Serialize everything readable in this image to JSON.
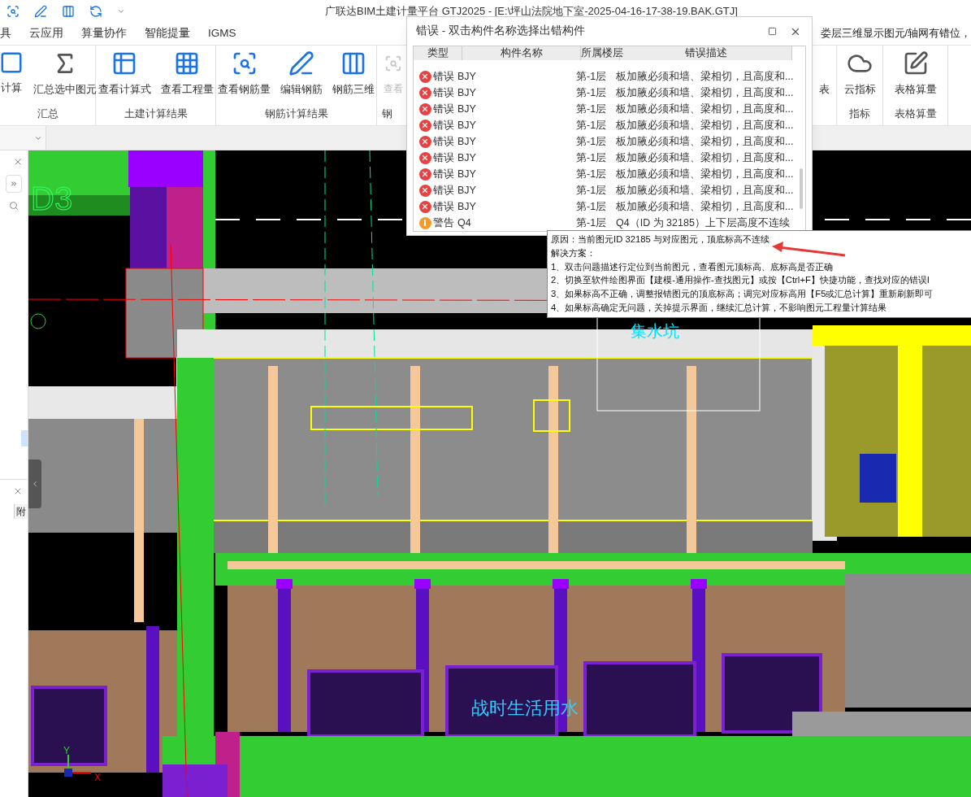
{
  "title_bar": {
    "title": "广联达BIM土建计量平台 GTJ2025 - [E:\\坪山法院地下室-2025-04-16-17-38-19.BAK.GTJ]"
  },
  "menu": [
    {
      "label": "具",
      "selected": false
    },
    {
      "label": "云应用",
      "selected": false
    },
    {
      "label": "算量协作",
      "selected": false
    },
    {
      "label": "智能提量",
      "selected": false
    },
    {
      "label": "IGMS",
      "selected": false
    }
  ],
  "notice": "娄层三维显示图元/轴网有错位，",
  "ribbon_left": [
    {
      "label": "汇总",
      "items": [
        {
          "kind": "calc",
          "label": "计算",
          "disabled": false
        },
        {
          "kind": "sum",
          "label": "汇总选中图元",
          "disabled": false
        }
      ]
    },
    {
      "label": "土建计算结果",
      "items": [
        {
          "kind": "formula",
          "label": "查看计算式",
          "disabled": false
        },
        {
          "kind": "quantity",
          "label": "查看工程量",
          "disabled": false
        }
      ]
    },
    {
      "label": "钢筋计算结果",
      "items": [
        {
          "kind": "rebar-qty",
          "label": "查看钢筋量",
          "disabled": false
        },
        {
          "kind": "rebar-edit",
          "label": "编辑钢筋",
          "disabled": false
        },
        {
          "kind": "rebar-3d",
          "label": "钢筋三维",
          "disabled": false
        }
      ]
    },
    {
      "label": "钢",
      "items": [
        {
          "kind": "view",
          "label": "查看",
          "disabled": true
        }
      ]
    }
  ],
  "ribbon_right": [
    {
      "items": [
        {
          "kind": "none",
          "label": "表",
          "disabled": false
        }
      ]
    },
    {
      "label": "指标",
      "items": [
        {
          "kind": "cloud-index",
          "label": "云指标",
          "disabled": false
        }
      ]
    },
    {
      "label": "表格算量",
      "items": [
        {
          "kind": "table-calc",
          "label": "表格算量",
          "disabled": false
        }
      ]
    }
  ],
  "dialog": {
    "title": "错误 - 双击构件名称选择出错构件",
    "columns": [
      "类型",
      "构件名称",
      "所属楼层",
      "错误描述"
    ],
    "rows": [
      {
        "kind": "error",
        "type": "错误",
        "name": "BJY",
        "floor": "第-1层",
        "description": "板加腋必须和墙、梁相切，且高度和..."
      },
      {
        "kind": "error",
        "type": "错误",
        "name": "BJY",
        "floor": "第-1层",
        "description": "板加腋必须和墙、梁相切，且高度和..."
      },
      {
        "kind": "error",
        "type": "错误",
        "name": "BJY",
        "floor": "第-1层",
        "description": "板加腋必须和墙、梁相切，且高度和..."
      },
      {
        "kind": "error",
        "type": "错误",
        "name": "BJY",
        "floor": "第-1层",
        "description": "板加腋必须和墙、梁相切，且高度和..."
      },
      {
        "kind": "error",
        "type": "错误",
        "name": "BJY",
        "floor": "第-1层",
        "description": "板加腋必须和墙、梁相切，且高度和..."
      },
      {
        "kind": "error",
        "type": "错误",
        "name": "BJY",
        "floor": "第-1层",
        "description": "板加腋必须和墙、梁相切，且高度和..."
      },
      {
        "kind": "error",
        "type": "错误",
        "name": "BJY",
        "floor": "第-1层",
        "description": "板加腋必须和墙、梁相切，且高度和..."
      },
      {
        "kind": "error",
        "type": "错误",
        "name": "BJY",
        "floor": "第-1层",
        "description": "板加腋必须和墙、梁相切，且高度和..."
      },
      {
        "kind": "error",
        "type": "错误",
        "name": "BJY",
        "floor": "第-1层",
        "description": "板加腋必须和墙、梁相切，且高度和..."
      },
      {
        "kind": "warning",
        "type": "警告",
        "name": "Q4",
        "floor": "第-1层",
        "description": "Q4（ID 为 32185）上下层高度不连续"
      }
    ]
  },
  "tooltip": {
    "lines": [
      "原因：当前图元ID 32185 与对应图元，顶底标高不连续",
      "解决方案：",
      "1、双击问题描述行定位到当前图元，查看图元顶标高、底标高是否正确",
      "2、切换至软件绘图界面【建模-通用操作-查找图元】或按【Ctrl+F】快捷功能，查找对应的错误I",
      "3、如果标高不正确，调整报错图元的顶底标高；调完对应标高用【F5或汇总计算】重新刷新即可",
      "4、如果标高确定无问题，关掉提示界面，继续汇总计算，不影响图元工程量计算结果"
    ]
  },
  "left_panel": {
    "column_header": "附"
  },
  "canvas": {
    "grid_label": "D3",
    "pit_label": "集水坑",
    "water_label": "战时生活用水",
    "axis_y": "Y",
    "axis_x": "X"
  }
}
